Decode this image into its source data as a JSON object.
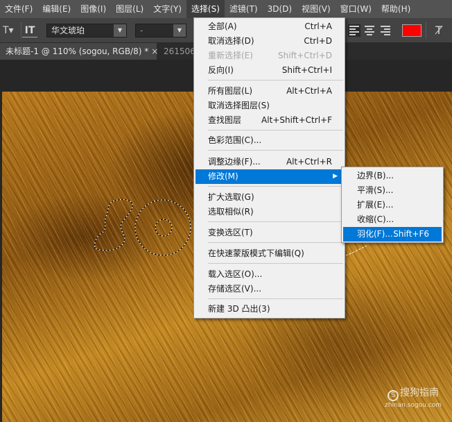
{
  "menubar": {
    "items": [
      "文件(F)",
      "编辑(E)",
      "图像(I)",
      "图层(L)",
      "文字(Y)",
      "选择(S)",
      "滤镜(T)",
      "3D(D)",
      "视图(V)",
      "窗口(W)",
      "帮助(H)"
    ],
    "active_index": 5
  },
  "optbar": {
    "font_family": "华文琥珀",
    "font_style": "-",
    "text_color": "#ff0000"
  },
  "tabs": {
    "active_label": "未标题-1 @ 110% (sogou, RGB/8) *",
    "close_glyph": "×",
    "inactive_label": "261506"
  },
  "select_menu": {
    "all": {
      "label": "全部(A)",
      "shortcut": "Ctrl+A"
    },
    "deselect": {
      "label": "取消选择(D)",
      "shortcut": "Ctrl+D"
    },
    "reselect": {
      "label": "重新选择(E)",
      "shortcut": "Shift+Ctrl+D"
    },
    "inverse": {
      "label": "反向(I)",
      "shortcut": "Shift+Ctrl+I"
    },
    "all_layers": {
      "label": "所有图层(L)",
      "shortcut": "Alt+Ctrl+A"
    },
    "deselect_layers": {
      "label": "取消选择图层(S)"
    },
    "find_layers": {
      "label": "查找图层",
      "shortcut": "Alt+Shift+Ctrl+F"
    },
    "color_range": {
      "label": "色彩范围(C)..."
    },
    "refine_edge": {
      "label": "调整边缘(F)...",
      "shortcut": "Alt+Ctrl+R"
    },
    "modify": {
      "label": "修改(M)",
      "arrow": "▶"
    },
    "grow": {
      "label": "扩大选取(G)"
    },
    "similar": {
      "label": "选取相似(R)"
    },
    "transform": {
      "label": "变换选区(T)"
    },
    "quick_mask": {
      "label": "在快速蒙版模式下编辑(Q)"
    },
    "load": {
      "label": "载入选区(O)..."
    },
    "save": {
      "label": "存储选区(V)..."
    },
    "new_3d": {
      "label": "新建 3D 凸出(3)"
    }
  },
  "modify_submenu": {
    "border": {
      "label": "边界(B)..."
    },
    "smooth": {
      "label": "平滑(S)..."
    },
    "expand": {
      "label": "扩展(E)..."
    },
    "contract": {
      "label": "收缩(C)..."
    },
    "feather": {
      "label": "羽化(F)...",
      "shortcut": "Shift+F6"
    }
  },
  "watermark": {
    "logo_glyph": "S",
    "brand": "搜狗指南",
    "url": "zhinan.sogou.com"
  },
  "icons": {
    "tool": "text-tool-icon",
    "orientation": "text-orientation-icon",
    "warp": "warp-text-icon"
  }
}
